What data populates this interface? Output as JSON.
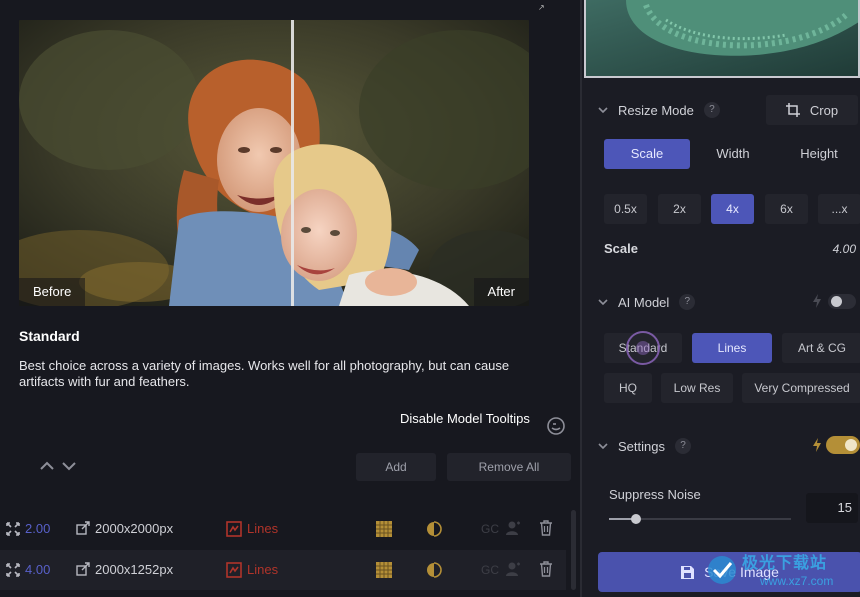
{
  "preview": {
    "before_label": "Before",
    "after_label": "After",
    "corner_mark": "↗"
  },
  "model_info": {
    "title": "Standard",
    "description": "Best choice across a variety of images. Works well for all photography, but can cause artifacts with fur and feathers.",
    "tooltips_toggle": "Disable Model Tooltips"
  },
  "queue": {
    "add_label": "Add",
    "remove_all_label": "Remove All",
    "rows": [
      {
        "scale": "2.00",
        "size": "2000x2000px",
        "model": "Lines",
        "gc": "GC"
      },
      {
        "scale": "4.00",
        "size": "2000x1252px",
        "model": "Lines",
        "gc": "GC"
      }
    ]
  },
  "resize": {
    "title": "Resize Mode",
    "help": "?",
    "crop_label": "Crop",
    "tabs": [
      "Scale",
      "Width",
      "Height"
    ],
    "active_tab": "Scale",
    "scale_options": [
      "0.5x",
      "2x",
      "4x",
      "6x",
      "...x"
    ],
    "active_scale": "4x",
    "scale_label": "Scale",
    "scale_value": "4.00"
  },
  "ai_model": {
    "title": "AI Model",
    "help": "?",
    "options": [
      "Standard",
      "Lines",
      "Art & CG",
      "HQ",
      "Low Res",
      "Very Compressed"
    ],
    "active": "Lines"
  },
  "settings": {
    "title": "Settings",
    "help": "?",
    "suppress_noise_label": "Suppress Noise",
    "suppress_noise_value": "15",
    "suppress_noise_fraction": 0.15
  },
  "save": {
    "label": "Save Image"
  },
  "watermark": {
    "text": "极光下载站",
    "url": "www.xz7.com"
  },
  "colors": {
    "accent": "#4d56b8",
    "model_red": "#b0342a",
    "gold": "#b48f37",
    "bg": "#17181f"
  }
}
